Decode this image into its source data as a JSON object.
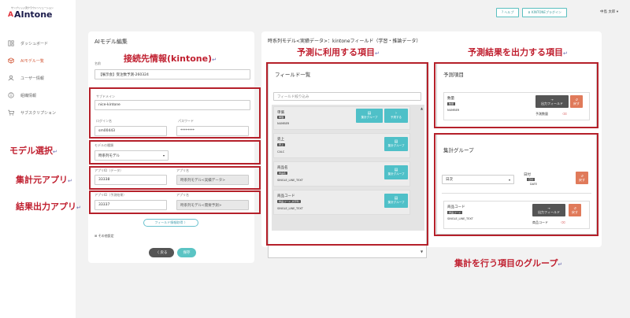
{
  "logo": {
    "tagline": "サンブリッジ流クラウドソリューション",
    "name": "AIntone",
    "mark": "A"
  },
  "header": {
    "help_label": "? ヘルプ",
    "plugin_label": "⬇ KINTONEプラグイン",
    "user_name": "中島 太郎 ▾"
  },
  "sidebar": {
    "items": [
      {
        "label": "ダッシュボード",
        "icon": "dashboard-icon"
      },
      {
        "label": "AIモデル一覧",
        "icon": "cube-icon",
        "active": true
      },
      {
        "label": "ユーザー情報",
        "icon": "user-icon"
      },
      {
        "label": "組織情報",
        "icon": "info-icon"
      },
      {
        "label": "サブスクリプション",
        "icon": "cart-icon"
      }
    ]
  },
  "model_card": {
    "title": "AIモデル編集",
    "name_label": "名前",
    "name_value": "【展示会】受注数予測-260324",
    "subdomain_label": "サブドメイン",
    "subdomain_value": "nice-kintone",
    "login_label": "ログイン名",
    "login_value": "sm00443",
    "password_label": "パスワード",
    "password_value": "********",
    "model_type_label": "モデルの種類",
    "model_type_value": "時系列モデル",
    "app_id_label1": "アプリID（データ）",
    "app_id_value1": "33338",
    "app_name_label1": "アプリ名",
    "app_name_value1": "時系列モデル<実績データ>",
    "app_id_label2": "アプリID（予測結果）",
    "app_id_value2": "33337",
    "app_name_label2": "アプリ名",
    "app_name_value2": "時系列モデル<需要予測>",
    "fetch_fields_label": "フィールド情報取得 〉",
    "other_settings_label": "⊞ その他設定",
    "back_label": "〈 戻る",
    "save_label": "保存"
  },
  "field_card": {
    "title": "時系列モデル<実績データ>：kintoneフィールド（学習・推論データ）",
    "list_title": "フィールド一覧",
    "filter_placeholder": "フィールド絞り込み",
    "fields": [
      {
        "name": "単価",
        "tag": "単価",
        "type": "NUMBER"
      },
      {
        "name": "売上",
        "tag": "売上",
        "type": "CALC"
      },
      {
        "name": "商品名",
        "tag": "商品名",
        "type": "SINGLE_LINE_TEXT"
      },
      {
        "name": "商品コード",
        "tag": "商品コード_文字列",
        "type": "SINGLE_LINE_TEXT"
      }
    ],
    "group_btn": "集計グループ",
    "predict_btn": "予測する"
  },
  "predict_card": {
    "title": "予測項目",
    "field_name": "数量",
    "field_tag": "数量",
    "field_type": "NUMBER",
    "output_btn": "出力フィールド",
    "return_btn": "戻す",
    "output_name": "予測数量"
  },
  "group_card": {
    "title": "集計グループ",
    "period_value": "日次",
    "date_name": "日付",
    "date_tag": "日付",
    "date_type": "DATE",
    "return_btn": "戻す",
    "field_name": "商品コード",
    "field_tag": "商品コード",
    "field_type": "SINGLE_LINE_TEXT",
    "output_btn": "出力フィールド",
    "output_name": "商品コード"
  },
  "annotations": {
    "a1": "接続先情報(kintone)",
    "a2": "予測に利用する項目",
    "a3": "予測結果を出力する項目",
    "a4": "モデル選択",
    "a5": "集計元アプリ",
    "a6": "結果出力アプリ",
    "a7": "集計を行う項目のグループ",
    "return_mark": "↵"
  },
  "colors": {
    "accent": "#5bc4c4",
    "annotation": "#c02030",
    "active_nav": "#d45a3a"
  }
}
